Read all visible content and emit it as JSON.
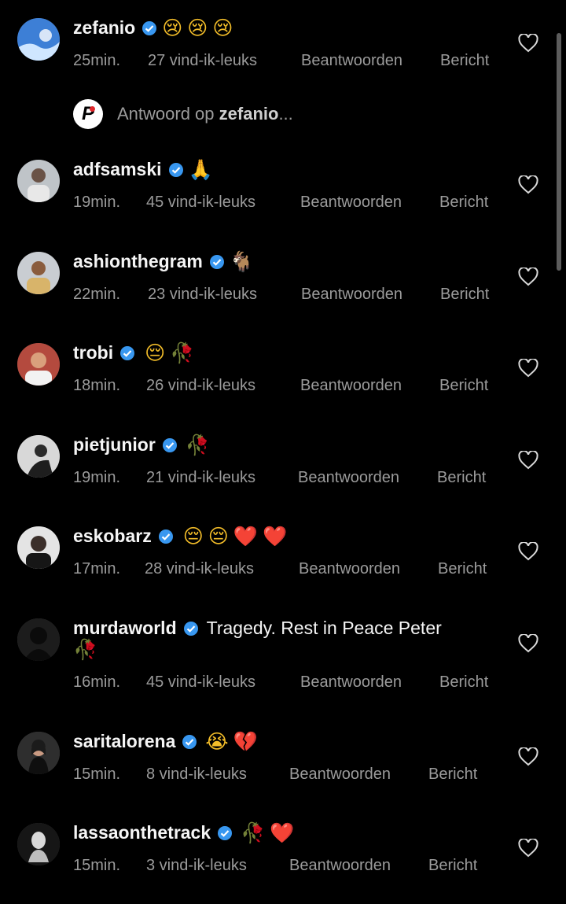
{
  "reply_prompt": {
    "prefix": "Antwoord op ",
    "username": "zefanio",
    "suffix": "..."
  },
  "actions": {
    "reply": "Beantwoorden",
    "message": "Bericht"
  },
  "comments": [
    {
      "username": "zefanio",
      "text": "",
      "emoji": [
        "😢",
        "😢",
        "😢"
      ],
      "time": "25min.",
      "likes": "27 vind-ik-leuks"
    },
    {
      "username": "adfsamski",
      "text": "",
      "emoji": [
        "🙏"
      ],
      "time": "19min.",
      "likes": "45 vind-ik-leuks"
    },
    {
      "username": "ashionthegram",
      "text": "",
      "emoji": [
        "🐐"
      ],
      "time": "22min.",
      "likes": "23 vind-ik-leuks"
    },
    {
      "username": "trobi",
      "text": "",
      "emoji": [
        "😔",
        "🥀"
      ],
      "time": "18min.",
      "likes": "26 vind-ik-leuks"
    },
    {
      "username": "pietjunior",
      "text": "",
      "emoji": [
        "🥀"
      ],
      "time": "19min.",
      "likes": "21 vind-ik-leuks"
    },
    {
      "username": "eskobarz",
      "text": "",
      "emoji": [
        "😔",
        "😔",
        "❤️",
        "❤️"
      ],
      "time": "17min.",
      "likes": "28 vind-ik-leuks"
    },
    {
      "username": "murdaworld",
      "text": "Tragedy. Rest in Peace Peter",
      "emoji": [
        "🥀"
      ],
      "time": "16min.",
      "likes": "45 vind-ik-leuks"
    },
    {
      "username": "saritalorena",
      "text": "",
      "emoji": [
        "😭",
        "💔"
      ],
      "time": "15min.",
      "likes": "8 vind-ik-leuks"
    },
    {
      "username": "lassaonthetrack",
      "text": "",
      "emoji": [
        "🥀",
        "❤️"
      ],
      "time": "15min.",
      "likes": "3 vind-ik-leuks"
    }
  ],
  "icons": {
    "verified": "verified-badge-icon",
    "like": "heart-outline-icon",
    "reply_avatar": "p-logo-icon"
  },
  "colors": {
    "background": "#000000",
    "verified": "#3897f0",
    "secondary_text": "#9b9b9b"
  }
}
